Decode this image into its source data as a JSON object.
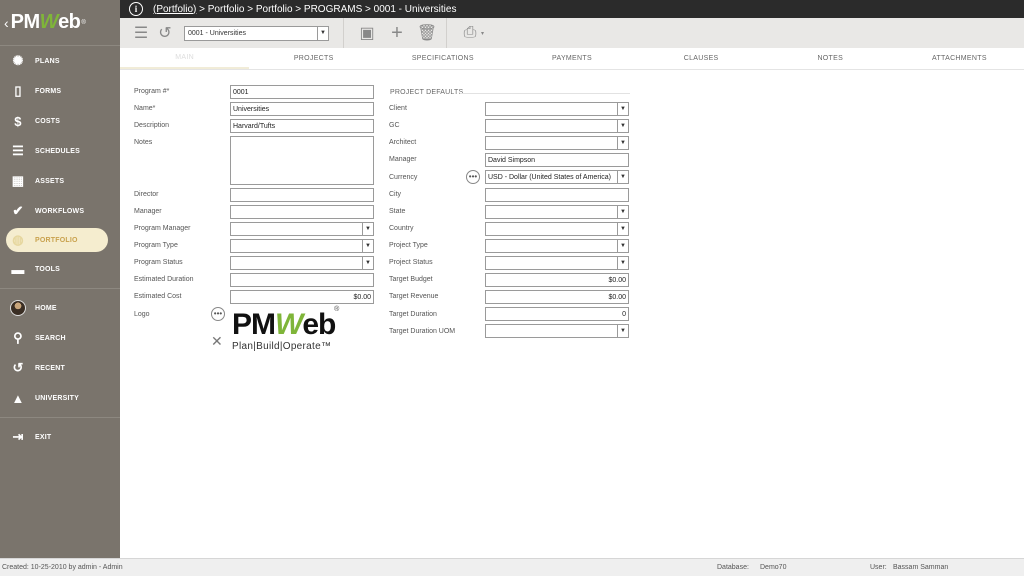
{
  "app": {
    "logo_text_a": "PM",
    "logo_text_w": "W",
    "logo_text_b": "eb",
    "reg": "®"
  },
  "sidebar": {
    "items": [
      {
        "label": "PLANS",
        "icon": "lightbulb-icon"
      },
      {
        "label": "FORMS",
        "icon": "document-icon"
      },
      {
        "label": "COSTS",
        "icon": "dollar-icon"
      },
      {
        "label": "SCHEDULES",
        "icon": "schedule-bars-icon"
      },
      {
        "label": "ASSETS",
        "icon": "building-icon"
      },
      {
        "label": "WORKFLOWS",
        "icon": "checkmark-icon"
      },
      {
        "label": "PORTFOLIO",
        "icon": "globe-icon"
      },
      {
        "label": "TOOLS",
        "icon": "toolbox-icon"
      }
    ],
    "bottom": [
      {
        "label": "HOME",
        "icon": "avatar"
      },
      {
        "label": "SEARCH",
        "icon": "search-icon"
      },
      {
        "label": "RECENT",
        "icon": "history-icon"
      },
      {
        "label": "UNIVERSITY",
        "icon": "graduation-cap-icon"
      }
    ],
    "exit": {
      "label": "EXIT",
      "icon": "exit-icon"
    },
    "active_index": 6
  },
  "breadcrumb": {
    "link": "(Portfolio)",
    "rest": " > Portfolio > Portfolio > PROGRAMS > 0001 - Universities"
  },
  "toolbar": {
    "record_select": "0001 - Universities"
  },
  "tabs": [
    "MAIN",
    "PROJECTS",
    "SPECIFICATIONS",
    "PAYMENTS",
    "CLAUSES",
    "NOTES",
    "ATTACHMENTS"
  ],
  "form": {
    "left": {
      "program_no_label": "Program #*",
      "program_no": "0001",
      "name_label": "Name*",
      "name": "Universities",
      "description_label": "Description",
      "description": "Harvard/Tufts",
      "notes_label": "Notes",
      "notes": "",
      "director_label": "Director",
      "director": "",
      "manager_label": "Manager",
      "manager": "",
      "program_manager_label": "Program Manager",
      "program_manager": "",
      "program_type_label": "Program Type",
      "program_type": "",
      "program_status_label": "Program Status",
      "program_status": "",
      "estimated_duration_label": "Estimated Duration",
      "estimated_duration": "",
      "estimated_cost_label": "Estimated Cost",
      "estimated_cost": "$0.00",
      "logo_label": "Logo",
      "logo_main_a": "PM",
      "logo_main_w": "W",
      "logo_main_b": "eb",
      "logo_tagline": "Plan|Build|Operate™"
    },
    "right": {
      "section_title": "PROJECT DEFAULTS",
      "client_label": "Client",
      "client": "",
      "gc_label": "GC",
      "gc": "",
      "architect_label": "Architect",
      "architect": "",
      "manager_label": "Manager",
      "manager": "David Simpson",
      "currency_label": "Currency",
      "currency": "USD - Dollar (United States of America)",
      "city_label": "City",
      "city": "",
      "state_label": "State",
      "state": "",
      "country_label": "Country",
      "country": "",
      "project_type_label": "Project Type",
      "project_type": "",
      "project_status_label": "Project Status",
      "project_status": "",
      "target_budget_label": "Target Budget",
      "target_budget": "$0.00",
      "target_revenue_label": "Target Revenue",
      "target_revenue": "$0.00",
      "target_duration_label": "Target Duration",
      "target_duration": "0",
      "target_duration_uom_label": "Target Duration UOM",
      "target_duration_uom": ""
    }
  },
  "status": {
    "created": "Created:   10-25-2010 by admin - Admin",
    "database_label": "Database:",
    "database": "Demo70",
    "user_label": "User:",
    "user": "Bassam Samman"
  }
}
